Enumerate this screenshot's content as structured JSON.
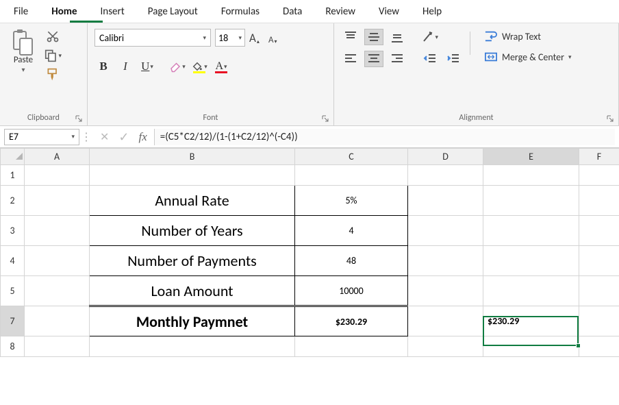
{
  "menu": {
    "items": [
      "File",
      "Home",
      "Insert",
      "Page Layout",
      "Formulas",
      "Data",
      "Review",
      "View",
      "Help"
    ],
    "active": 1
  },
  "ribbon": {
    "clipboard": {
      "paste": "Paste",
      "label": "Clipboard"
    },
    "font": {
      "name": "Calibri",
      "size": "18",
      "bold": "B",
      "italic": "I",
      "underline": "U",
      "label": "Font"
    },
    "alignment": {
      "wrap": "Wrap Text",
      "merge": "Merge & Center",
      "label": "Alignment"
    }
  },
  "formula_bar": {
    "name_box": "E7",
    "fx": "fx",
    "formula": "=(C5*C2/12)/(1-(1+C2/12)^(-C4))"
  },
  "columns": [
    "A",
    "B",
    "C",
    "D",
    "E",
    "F"
  ],
  "rows": [
    "1",
    "2",
    "3",
    "4",
    "5",
    "7",
    "8"
  ],
  "cells": {
    "B2": "Annual Rate",
    "C2": "5%",
    "B3": "Number of Years",
    "C3": "4",
    "B4": "Number of Payments",
    "C4": "48",
    "B5": "Loan Amount",
    "C5": "10000",
    "B7": "Monthly Paymnet",
    "C7": "$230.29",
    "E7": "$230.29"
  },
  "active_cell": "E7",
  "chart_data": {
    "type": "table",
    "title": "Loan payment calculation",
    "rows": [
      {
        "label": "Annual Rate",
        "value": "5%"
      },
      {
        "label": "Number of Years",
        "value": 4
      },
      {
        "label": "Number of Payments",
        "value": 48
      },
      {
        "label": "Loan Amount",
        "value": 10000
      },
      {
        "label": "Monthly Paymnet",
        "value": 230.29
      }
    ],
    "formula_cell": {
      "ref": "E7",
      "formula": "=(C5*C2/12)/(1-(1+C2/12)^(-C4))",
      "value": 230.29
    }
  }
}
